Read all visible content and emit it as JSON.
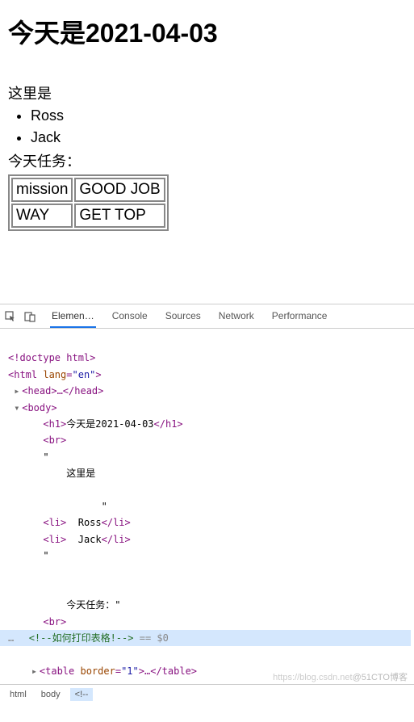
{
  "page": {
    "title": "今天是2021-04-03",
    "intro": "这里是",
    "list": [
      "Ross",
      "Jack"
    ],
    "task_label": "今天任务：",
    "table": [
      [
        "mission",
        "GOOD JOB"
      ],
      [
        "WAY",
        "GET TOP"
      ]
    ]
  },
  "devtools": {
    "tabs": [
      "Elemen…",
      "Console",
      "Sources",
      "Network",
      "Performance"
    ],
    "active_tab": 0,
    "code": {
      "l0": "<!doctype html>",
      "l1_open": "<html ",
      "l1_attr_n": "lang",
      "l1_attr_v": "\"en\"",
      "l1_close": ">",
      "l2": "<head>…</head>",
      "l3": "<body>",
      "l4_open": "<h1>",
      "l4_txt": "今天是2021-04-03",
      "l4_close": "</h1>",
      "l5": "<br>",
      "l6": "\"",
      "l7": "这里是",
      "l8": "\"",
      "l9_open": "<li>",
      "l9_txt": "  Ross",
      "l9_close": "</li>",
      "l10_open": "<li>",
      "l10_txt": "  Jack",
      "l10_close": "</li>",
      "l11": "\"",
      "l12": "今天任务：\"",
      "l13": "<br>",
      "l14": "<!--如何打印表格!-->",
      "l14_sel": " == $0",
      "l15_open": "<table ",
      "l15_attr_n": "border",
      "l15_attr_v": "\"1\"",
      "l15_mid": ">…",
      "l15_close": "</table>"
    },
    "breadcrumb": [
      "html",
      "body",
      "<!--"
    ],
    "watermark1": "https://blog.csdn.net",
    "watermark2": "@51CTO博客"
  }
}
